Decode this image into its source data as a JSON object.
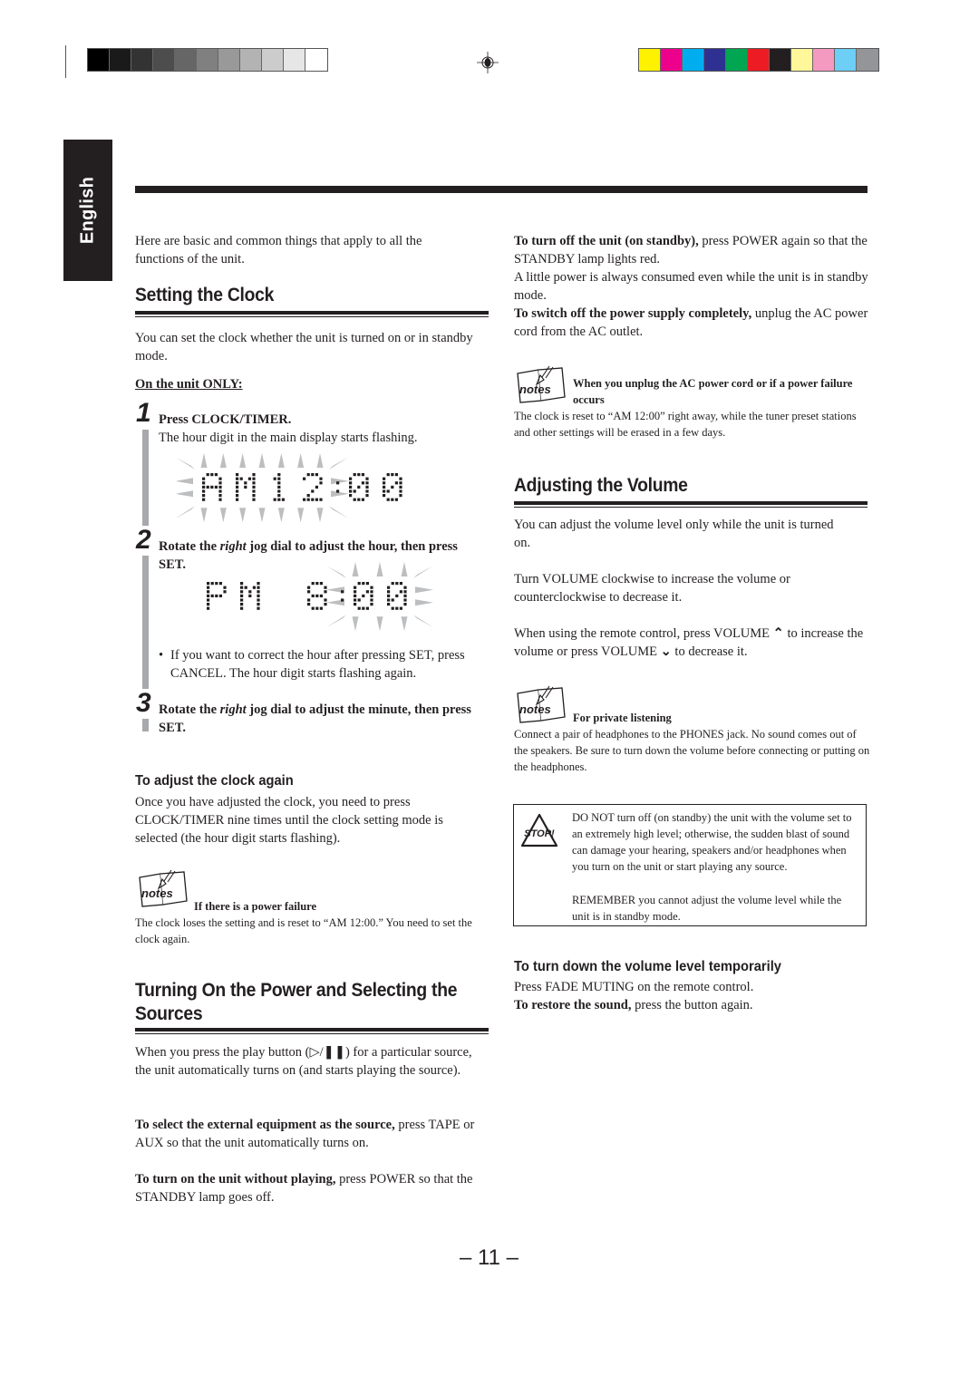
{
  "print_marks": {
    "gray_swatches": [
      "#000000",
      "#1a1a1a",
      "#333333",
      "#4d4d4d",
      "#666666",
      "#808080",
      "#999999",
      "#b3b3b3",
      "#cccccc",
      "#e6e6e6",
      "#ffffff"
    ],
    "color_swatches": [
      "#fff200",
      "#ec008c",
      "#00aeef",
      "#2e3192",
      "#00a651",
      "#ed1c24",
      "#231f20",
      "#fff799",
      "#f49ac1",
      "#6dcff6",
      "#939598"
    ]
  },
  "language_tab": "English",
  "intro": "Here are basic and common things that apply to all the functions of the unit.",
  "setting_clock": {
    "title": "Setting the Clock",
    "intro": "You can set the clock whether the unit is turned on or in standby mode.",
    "unit_only": "On the unit ONLY:",
    "steps": [
      {
        "num": "1",
        "title": "Press CLOCK/TIMER.",
        "body": "The hour digit in the main display starts flashing.",
        "display": "AM12:00"
      },
      {
        "num": "2",
        "title_pre": "Rotate the ",
        "title_em": "right",
        "title_post": " jog dial to adjust the hour, then press SET.",
        "display": "PM 8:00",
        "bullet": "If you want to correct the hour after pressing SET, press CANCEL. The hour digit starts flashing again."
      },
      {
        "num": "3",
        "title_pre": "Rotate the ",
        "title_em": "right",
        "title_post": " jog dial to adjust the minute, then press SET."
      }
    ],
    "adjust_again": {
      "title": "To adjust the clock again",
      "body": "Once you have adjusted the clock, you need to press CLOCK/TIMER nine times until the clock setting mode is selected (the hour digit starts flashing)."
    },
    "note": {
      "icon": "notes-icon",
      "title": "If there is a power failure",
      "body": "The clock loses the setting and is reset to “AM 12:00.” You need to set the clock again."
    }
  },
  "power": {
    "title": "Turning On the Power and Selecting the Sources",
    "intro": "When you press the play button (▷/❚❚) for a particular source, the unit automatically turns on (and starts playing the source).",
    "external_bold": "To select the external equipment as the source,",
    "external_rest": " press TAPE or AUX so that the unit automatically turns on.",
    "on_bold": "To turn on the unit without playing,",
    "on_rest": " press POWER so that the STANDBY lamp goes off.",
    "off_bold": "To turn off the unit (on standby),",
    "off_rest": " press POWER again so that the STANDBY lamp lights red.",
    "standby_note": "A little power is always consumed even while the unit is in standby mode.",
    "switch_bold": "To switch off the power supply completely,",
    "switch_rest": " unplug the AC power cord from the AC outlet.",
    "note": {
      "icon": "notes-icon",
      "title": "When you unplug the AC power cord or if a power failure occurs",
      "body": "The clock is reset to “AM 12:00” right away, while the tuner preset stations and other settings will be erased in a few days."
    }
  },
  "volume": {
    "title": "Adjusting the Volume",
    "p1": "You can adjust the volume level only while the unit is turned on.",
    "p2": "Turn VOLUME clockwise to increase the volume or counterclockwise to decrease it.",
    "p3_a": "When using the remote control, press VOLUME ",
    "p3_up": "⌃",
    "p3_b": " to increase the volume or press VOLUME ",
    "p3_down": "⌄",
    "p3_c": " to decrease it.",
    "note": {
      "icon": "notes-icon",
      "title": "For private listening",
      "body": "Connect a pair of headphones to the PHONES jack. No sound comes out of the speakers. Be sure to turn down the volume before connecting or putting on the headphones."
    },
    "caution": {
      "icon": "stop-icon",
      "icon_label": "STOP!",
      "body": "DO NOT turn off (on standby) the unit with the volume set to an extremely high level; otherwise, the sudden blast of sound can damage your hearing, speakers and/or headphones when you turn on the unit or start playing any source.",
      "remember": "REMEMBER you cannot adjust the volume level while the unit is in standby mode."
    },
    "temporary": {
      "title": "To turn down the volume level temporarily",
      "body": "Press FADE MUTING on the remote control.",
      "restore_bold": "To restore the sound,",
      "restore_rest": " press the button again."
    }
  },
  "page_number": "– 11 –"
}
